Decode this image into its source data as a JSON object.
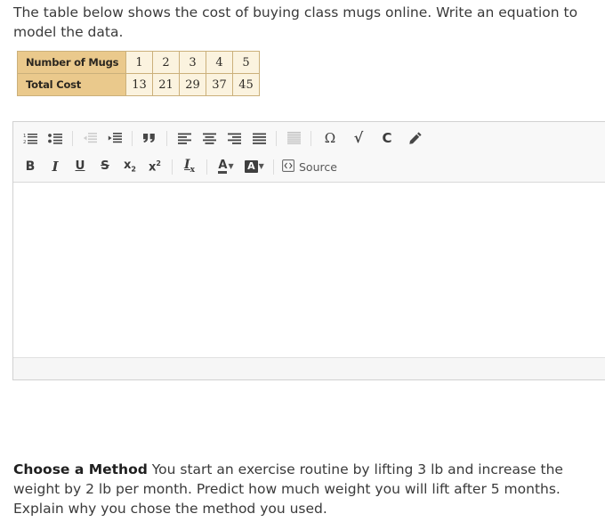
{
  "question_top": {
    "text": "The table below shows the cost of buying class mugs online. Write an equation to model the data."
  },
  "data_table": {
    "rows": [
      {
        "header": "Number of Mugs",
        "cells": [
          "1",
          "2",
          "3",
          "4",
          "5"
        ]
      },
      {
        "header": "Total Cost",
        "cells": [
          "13",
          "21",
          "29",
          "37",
          "45"
        ]
      }
    ],
    "colors": {
      "header_bg": "#eac98c",
      "cell_bg": "#fbf3df",
      "border": "#cbb07b"
    }
  },
  "editor": {
    "toolbar_row1": [
      {
        "name": "numbered-list-icon",
        "title": "Insert/Remove Numbered List",
        "glyph": "numbered-list",
        "disabled": false
      },
      {
        "name": "bulleted-list-icon",
        "title": "Insert/Remove Bulleted List",
        "glyph": "bulleted-list",
        "disabled": false
      },
      {
        "name": "decrease-indent-icon",
        "title": "Decrease Indent",
        "glyph": "outdent",
        "disabled": true
      },
      {
        "name": "increase-indent-icon",
        "title": "Increase Indent",
        "glyph": "indent",
        "disabled": false
      },
      {
        "name": "blockquote-icon",
        "title": "Block Quote",
        "glyph": "quote",
        "disabled": false
      },
      {
        "name": "align-left-icon",
        "title": "Align Left",
        "glyph": "align-left",
        "disabled": false
      },
      {
        "name": "align-center-icon",
        "title": "Center",
        "glyph": "align-center",
        "disabled": false
      },
      {
        "name": "align-right-icon",
        "title": "Align Right",
        "glyph": "align-right",
        "disabled": false
      },
      {
        "name": "justify-icon",
        "title": "Justify",
        "glyph": "justify",
        "disabled": false
      },
      {
        "name": "horizontal-rule-icon",
        "title": "Insert Horizontal Line",
        "glyph": "hrule",
        "disabled": false
      },
      {
        "name": "special-character-icon",
        "title": "Insert Special Character",
        "glyph": "omega",
        "label": "Ω",
        "disabled": false
      },
      {
        "name": "square-root-icon",
        "title": "Insert Math Equation",
        "glyph": "radical",
        "label": "√",
        "disabled": false
      },
      {
        "name": "chemistry-icon",
        "title": "Insert Chemistry Formula",
        "glyph": "chem",
        "label": "C",
        "disabled": false
      },
      {
        "name": "pencil-draw-icon",
        "title": "Draw",
        "glyph": "pencil",
        "disabled": false
      }
    ],
    "toolbar_row2": [
      {
        "name": "bold-button",
        "title": "Bold",
        "glyph": "bold",
        "label": "B"
      },
      {
        "name": "italic-button",
        "title": "Italic",
        "glyph": "italic",
        "label": "I"
      },
      {
        "name": "underline-button",
        "title": "Underline",
        "glyph": "underline",
        "label": "U"
      },
      {
        "name": "strikethrough-button",
        "title": "Strikethrough",
        "glyph": "strike",
        "label": "S"
      },
      {
        "name": "subscript-button",
        "title": "Subscript",
        "glyph": "subscript",
        "label": "x"
      },
      {
        "name": "superscript-button",
        "title": "Superscript",
        "glyph": "superscript",
        "label": "x"
      },
      {
        "name": "remove-format-button",
        "title": "Remove Format",
        "glyph": "removeformat",
        "label": "I"
      },
      {
        "name": "text-color-button",
        "title": "Text Color",
        "glyph": "textcolor",
        "label": "A"
      },
      {
        "name": "background-color-button",
        "title": "Background Color",
        "glyph": "bgcolor",
        "label": "A"
      }
    ],
    "source_button": {
      "label": "Source",
      "icon": "source-code-icon"
    },
    "content_value": "",
    "content_placeholder": ""
  },
  "question_bottom": {
    "label": "Choose a Method",
    "text": " You start an exercise routine by lifting 3 lb and increase the weight by 2 lb per month. Predict how much weight you will lift after 5 months. Explain why you chose the method you used."
  }
}
